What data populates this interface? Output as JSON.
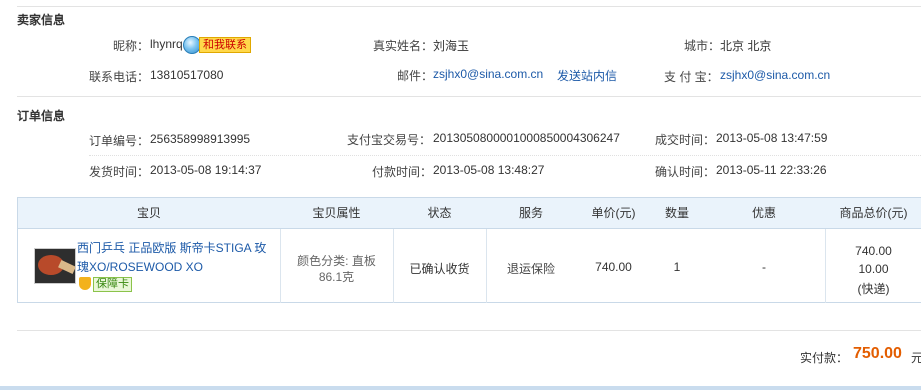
{
  "seller": {
    "title": "卖家信息",
    "nickname_label": "昵称：",
    "nickname": "lhynrq",
    "contact_label": "和我联系",
    "real_name_label": "真实姓名：",
    "real_name": "刘海玉",
    "city_label": "城市：",
    "city": "北京 北京",
    "phone_label": "联系电话：",
    "phone": "13810517080",
    "email_label": "邮件：",
    "email": "zsjhx0@sina.com.cn",
    "send_message": "发送站内信",
    "alipay_label": "支 付 宝：",
    "alipay": "zsjhx0@sina.com.cn"
  },
  "order": {
    "title": "订单信息",
    "order_no_label": "订单编号：",
    "order_no": "256358998913995",
    "alipay_tx_label": "支付宝交易号：",
    "alipay_tx": "2013050800001000850004306247",
    "deal_time_label": "成交时间：",
    "deal_time": "2013-05-08 13:47:59",
    "ship_time_label": "发货时间：",
    "ship_time": "2013-05-08 19:14:37",
    "pay_time_label": "付款时间：",
    "pay_time": "2013-05-08 13:48:27",
    "confirm_time_label": "确认时间：",
    "confirm_time": "2013-05-11 22:33:26"
  },
  "table": {
    "headers": [
      "宝贝",
      "宝贝属性",
      "状态",
      "服务",
      "单价(元)",
      "数量",
      "优惠",
      "商品总价(元)"
    ],
    "row": {
      "item_title_line1": "西门乒乓 正品欧版 斯帝卡STIGA 玫",
      "item_title_line2": "瑰XO/ROSEWOOD XO",
      "guarantee_label": "保障卡",
      "attr_line1": "颜色分类: 直板",
      "attr_line2": "86.1克",
      "status": "已确认收货",
      "service": "退运保险",
      "unit_price": "740.00",
      "quantity": "1",
      "discount": "-",
      "total_line1": "740.00",
      "total_line2": "10.00",
      "total_line3": "(快递)"
    }
  },
  "summary": {
    "paid_label": "实付款：",
    "paid_amount": "750.00",
    "unit": "元"
  },
  "colors": {
    "link": "#1d5aa8",
    "accent_total": "#e35d00",
    "table_header_bg": "#eaf3fb"
  }
}
